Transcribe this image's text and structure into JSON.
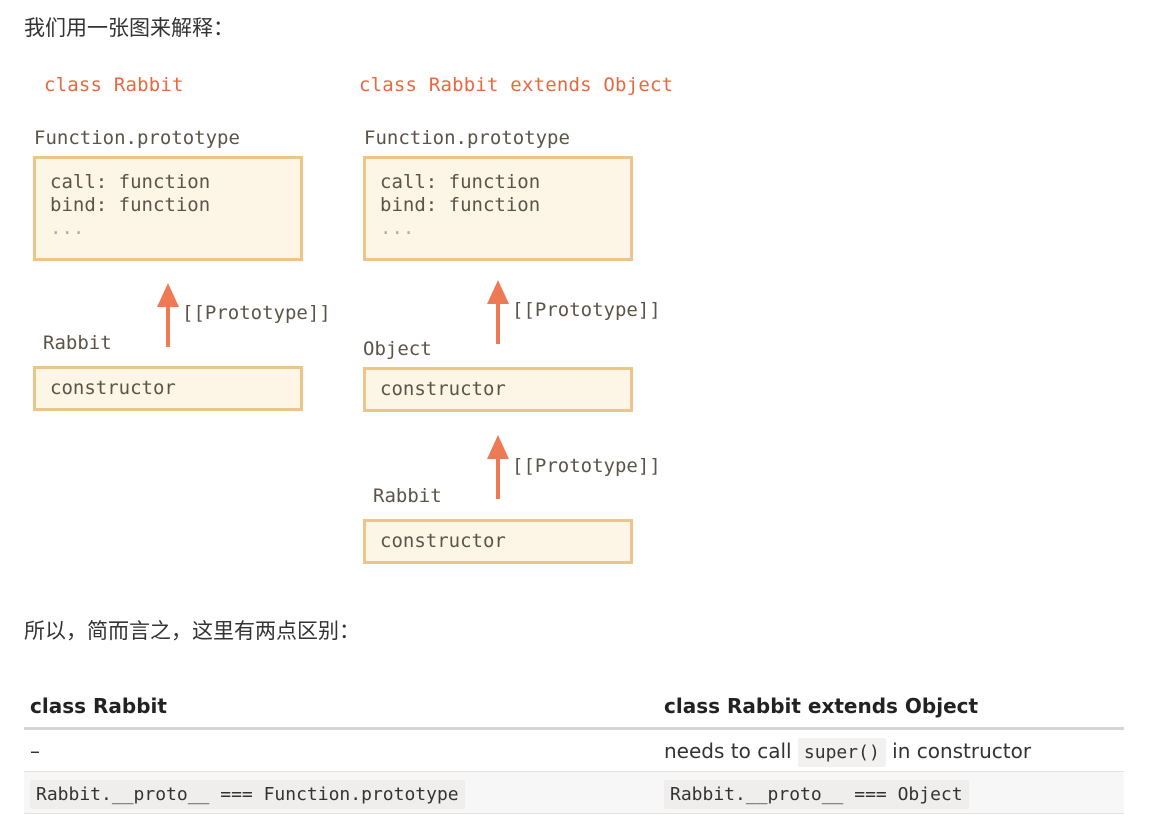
{
  "intro_text": "我们用一张图来解释：",
  "summary_text": "所以，简而言之，这里有两点区别：",
  "colors": {
    "title_red": "#e8683f",
    "arrow_red": "#ed7955",
    "box_fill": "#fdf5e6",
    "box_border": "#edc58a",
    "text_brown": "#5c5448"
  },
  "diagram": {
    "left": {
      "title": "class Rabbit",
      "proto_obj_label": "Function.prototype",
      "proto_lines": [
        "call: function",
        "bind: function",
        "..."
      ],
      "arrow_label": "[[Prototype]]",
      "rabbit_label": "Rabbit",
      "rabbit_box": "constructor"
    },
    "right": {
      "title": "class Rabbit extends Object",
      "proto_obj_label": "Function.prototype",
      "proto_lines": [
        "call: function",
        "bind: function",
        "..."
      ],
      "arrow1_label": "[[Prototype]]",
      "object_label": "Object",
      "object_box": "constructor",
      "arrow2_label": "[[Prototype]]",
      "rabbit_label": "Rabbit",
      "rabbit_box": "constructor"
    }
  },
  "table": {
    "headers": [
      "class Rabbit",
      "class Rabbit extends Object"
    ],
    "row1": {
      "left": "–",
      "right_prefix": "needs to call",
      "right_code": "super()",
      "right_suffix": "in constructor"
    },
    "row2": {
      "left_code": "Rabbit.__proto__ === Function.prototype",
      "right_code": "Rabbit.__proto__ === Object"
    }
  }
}
